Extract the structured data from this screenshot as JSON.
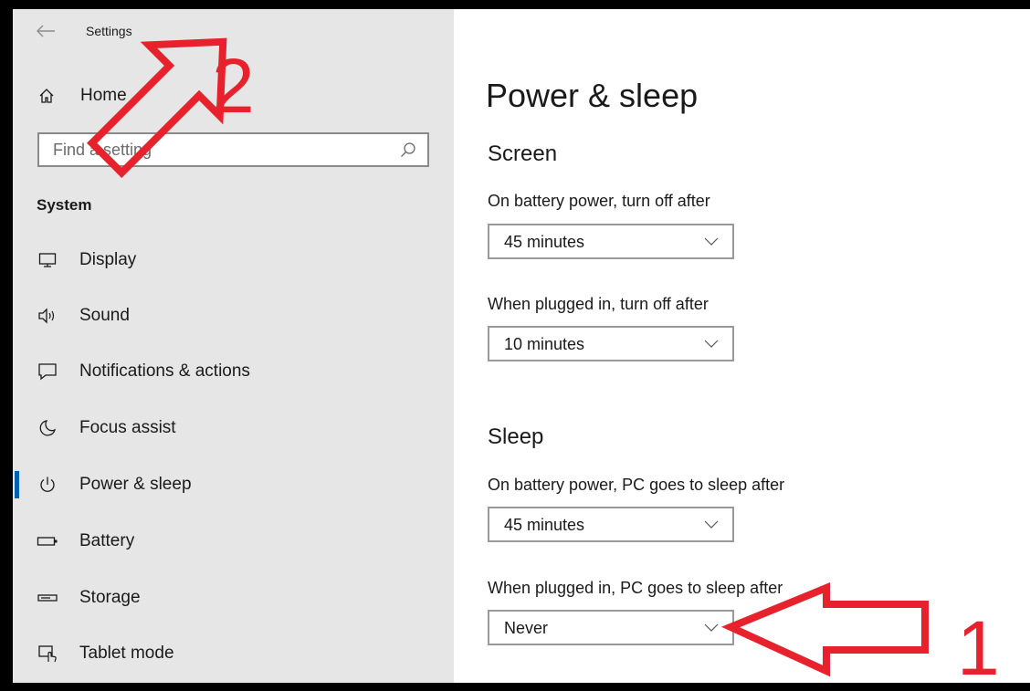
{
  "window": {
    "title": "Settings"
  },
  "sidebar": {
    "home_label": "Home",
    "search_placeholder": "Find a setting",
    "section_heading": "System",
    "items": [
      {
        "label": "Display",
        "icon": "monitor-icon"
      },
      {
        "label": "Sound",
        "icon": "speaker-icon"
      },
      {
        "label": "Notifications & actions",
        "icon": "notification-icon"
      },
      {
        "label": "Focus assist",
        "icon": "moon-icon"
      },
      {
        "label": "Power & sleep",
        "icon": "power-icon",
        "active": true
      },
      {
        "label": "Battery",
        "icon": "battery-icon"
      },
      {
        "label": "Storage",
        "icon": "storage-icon"
      },
      {
        "label": "Tablet mode",
        "icon": "tablet-mode-icon"
      }
    ]
  },
  "main": {
    "title": "Power & sleep",
    "screen": {
      "heading": "Screen",
      "battery_label": "On battery power, turn off after",
      "battery_value": "45 minutes",
      "plugged_label": "When plugged in, turn off after",
      "plugged_value": "10 minutes"
    },
    "sleep": {
      "heading": "Sleep",
      "battery_label": "On battery power, PC goes to sleep after",
      "battery_value": "45 minutes",
      "plugged_label": "When plugged in, PC goes to sleep after",
      "plugged_value": "Never"
    }
  },
  "annotations": {
    "label_1": "1",
    "label_2": "2",
    "color": "#e8222c"
  },
  "colors": {
    "accent": "#0063b1",
    "sidebar_bg": "#e6e6e6"
  }
}
